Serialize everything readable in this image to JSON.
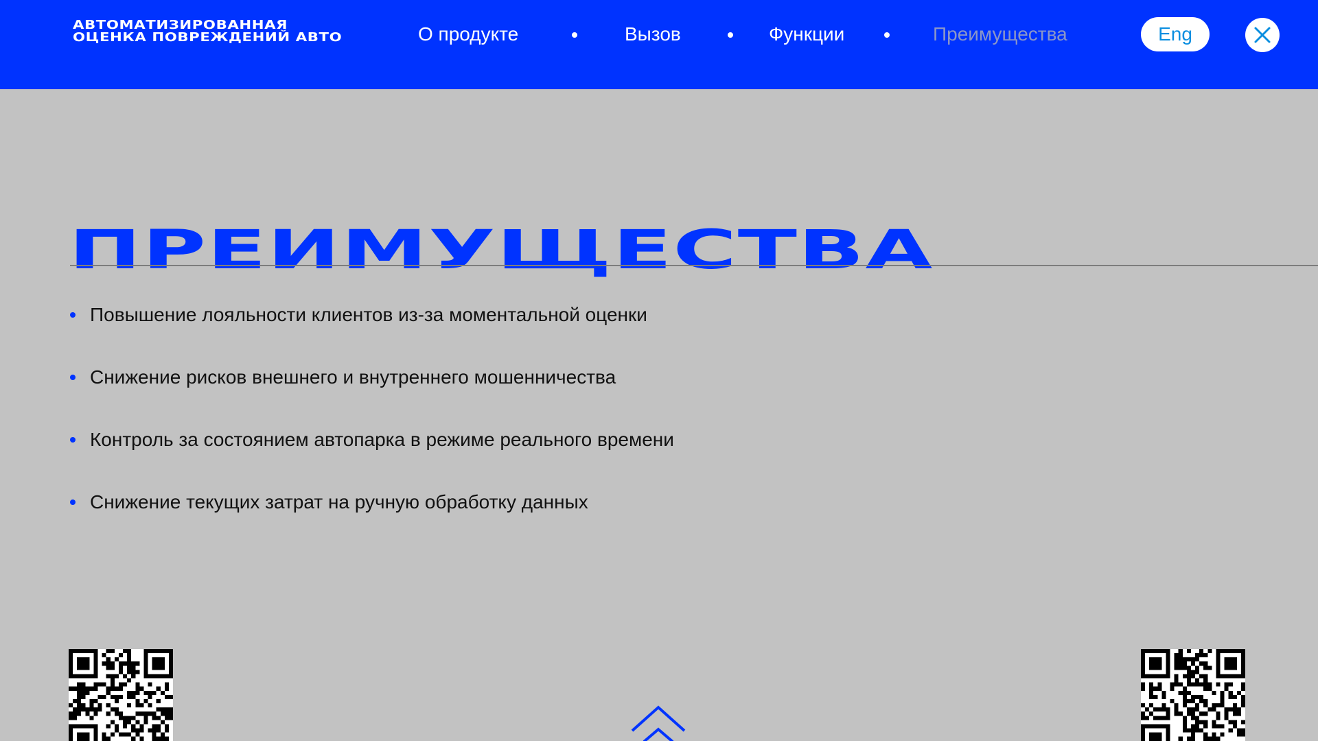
{
  "header": {
    "logo_line1": "Автоматизированная",
    "logo_line2": "оценка повреждений авто",
    "nav": [
      {
        "label": "О продукте"
      },
      {
        "label": "Вызов"
      },
      {
        "label": "Функции"
      },
      {
        "label": "Преимущества",
        "active": true
      }
    ],
    "lang_label": "Eng",
    "close_icon": "close-icon"
  },
  "main": {
    "title": "Преимущества",
    "benefits": [
      "Повышение лояльности клиентов из-за моментальной оценки",
      "Снижение рисков внешнего и внутреннего мошенничества",
      "Контроль за состоянием автопарка в режиме реального времени",
      "Снижение текущих затрат на ручную обработку данных"
    ]
  },
  "footer": {
    "qr_left_icon": "qr-code-icon",
    "qr_right_icon": "qr-code-icon",
    "scroll_up_icon": "chevron-up-icon"
  },
  "colors": {
    "brand": "#0033ff",
    "background": "#c2c2c2",
    "active_nav": "#8a96c8",
    "lang_text": "#0a8ee0"
  }
}
